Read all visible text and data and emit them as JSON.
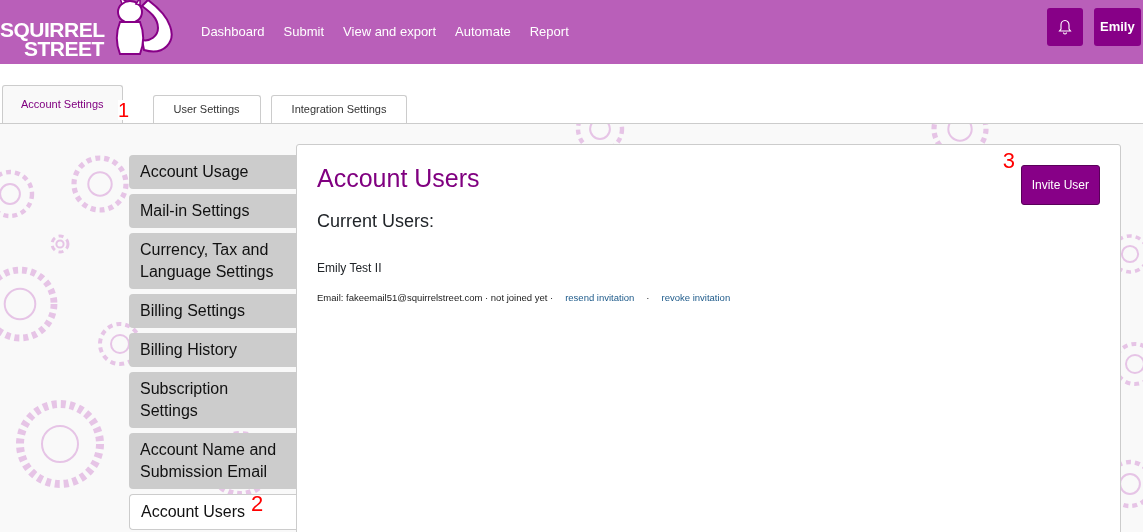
{
  "navbar": {
    "brand_lines": [
      "SQUIRREL",
      "STREET"
    ],
    "links": [
      "Dashboard",
      "Submit",
      "View and export",
      "Automate",
      "Report"
    ],
    "user_button": "Emily"
  },
  "tabs": [
    {
      "label": "Account Settings",
      "selected": true,
      "annotation": "1"
    },
    {
      "label": "User Settings",
      "selected": false
    },
    {
      "label": "Integration Settings",
      "selected": false
    }
  ],
  "sidebar": {
    "items": [
      {
        "label": "Account Usage",
        "selected": false
      },
      {
        "label": "Mail-in Settings",
        "selected": false
      },
      {
        "label": "Currency, Tax and Language Settings",
        "selected": false
      },
      {
        "label": "Billing Settings",
        "selected": false
      },
      {
        "label": "Billing History",
        "selected": false
      },
      {
        "label": "Subscription Settings",
        "selected": false
      },
      {
        "label": "Account Name and Submission Email",
        "selected": false
      },
      {
        "label": "Account Users",
        "selected": true,
        "annotation": "2"
      }
    ]
  },
  "panel": {
    "title": "Account Users",
    "invite_button": "Invite User",
    "invite_annotation": "3",
    "section_title": "Current Users:",
    "users": [
      {
        "name": "Emily Test II",
        "details": "Email: fakeemail51@squirrelstreet.com · not joined yet ·",
        "links": [
          "resend invitation",
          "revoke invitation"
        ],
        "separator": "·"
      }
    ]
  }
}
